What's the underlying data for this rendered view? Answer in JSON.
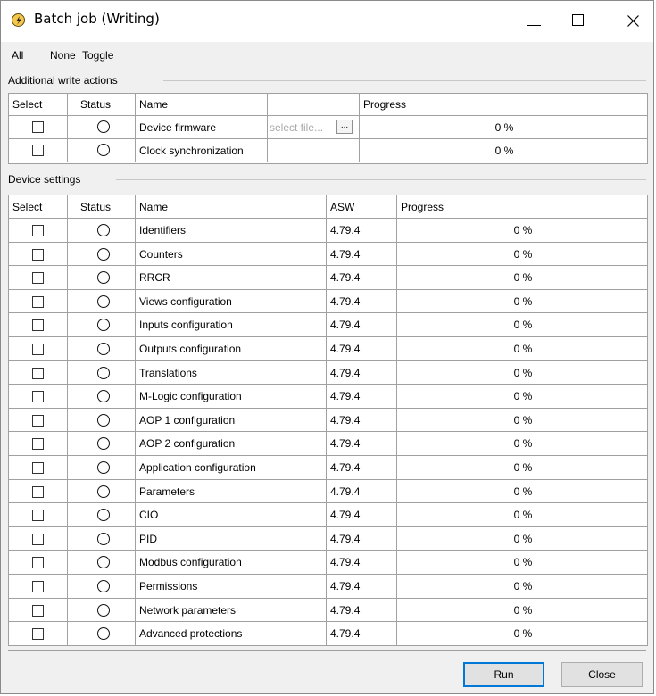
{
  "window": {
    "title": "Batch job (Writing)"
  },
  "menu": [
    "All",
    "None",
    "Toggle"
  ],
  "additional": {
    "group_label": "Additional write actions",
    "headers": {
      "select": "Select",
      "status": "Status",
      "name": "Name",
      "progress": "Progress"
    },
    "rows": [
      {
        "name": "Device firmware",
        "file_placeholder": "select file...",
        "browse": "...",
        "progress": "0 %"
      },
      {
        "name": "Clock synchronization",
        "progress": "0 %"
      }
    ]
  },
  "settings": {
    "group_label": "Device settings",
    "headers": {
      "select": "Select",
      "status": "Status",
      "name": "Name",
      "asw": "ASW",
      "progress": "Progress"
    },
    "rows": [
      {
        "name": "Identifiers",
        "asw": "4.79.4",
        "progress": "0 %"
      },
      {
        "name": "Counters",
        "asw": "4.79.4",
        "progress": "0 %"
      },
      {
        "name": "RRCR",
        "asw": "4.79.4",
        "progress": "0 %"
      },
      {
        "name": "Views configuration",
        "asw": "4.79.4",
        "progress": "0 %"
      },
      {
        "name": "Inputs configuration",
        "asw": "4.79.4",
        "progress": "0 %"
      },
      {
        "name": "Outputs configuration",
        "asw": "4.79.4",
        "progress": "0 %"
      },
      {
        "name": "Translations",
        "asw": "4.79.4",
        "progress": "0 %"
      },
      {
        "name": "M-Logic configuration",
        "asw": "4.79.4",
        "progress": "0 %"
      },
      {
        "name": "AOP 1 configuration",
        "asw": "4.79.4",
        "progress": "0 %"
      },
      {
        "name": "AOP 2 configuration",
        "asw": "4.79.4",
        "progress": "0 %"
      },
      {
        "name": "Application configuration",
        "asw": "4.79.4",
        "progress": "0 %"
      },
      {
        "name": "Parameters",
        "asw": "4.79.4",
        "progress": "0 %"
      },
      {
        "name": "CIO",
        "asw": "4.79.4",
        "progress": "0 %"
      },
      {
        "name": "PID",
        "asw": "4.79.4",
        "progress": "0 %"
      },
      {
        "name": "Modbus configuration",
        "asw": "4.79.4",
        "progress": "0 %"
      },
      {
        "name": "Permissions",
        "asw": "4.79.4",
        "progress": "0 %"
      },
      {
        "name": "Network parameters",
        "asw": "4.79.4",
        "progress": "0 %"
      },
      {
        "name": "Advanced protections",
        "asw": "4.79.4",
        "progress": "0 %"
      }
    ]
  },
  "buttons": {
    "run": "Run",
    "close": "Close"
  }
}
